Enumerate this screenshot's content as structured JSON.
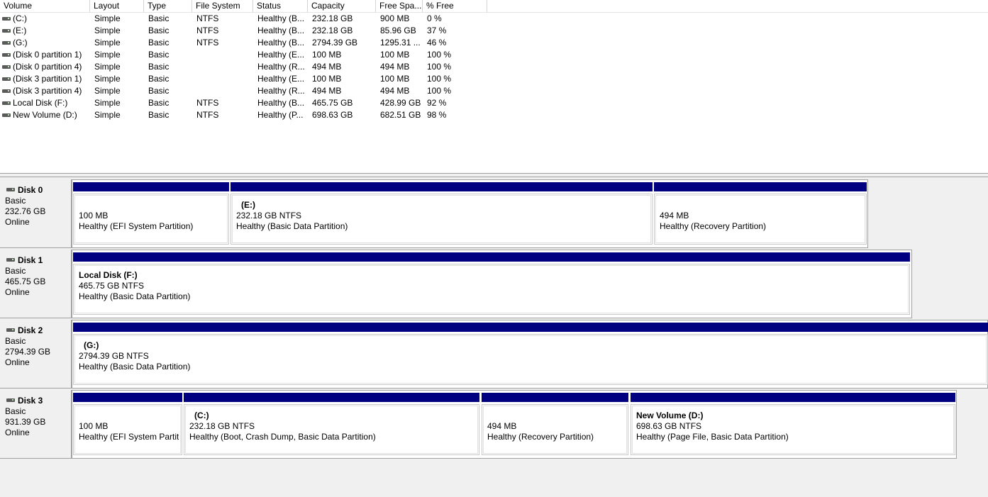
{
  "columns": [
    "Volume",
    "Layout",
    "Type",
    "File System",
    "Status",
    "Capacity",
    "Free Spa...",
    "% Free"
  ],
  "volumes": [
    {
      "volume": "(C:)",
      "layout": "Simple",
      "type": "Basic",
      "fs": "NTFS",
      "status": "Healthy (B...",
      "capacity": "232.18 GB",
      "free": "900 MB",
      "pct": "0 %"
    },
    {
      "volume": "(E:)",
      "layout": "Simple",
      "type": "Basic",
      "fs": "NTFS",
      "status": "Healthy (B...",
      "capacity": "232.18 GB",
      "free": "85.96 GB",
      "pct": "37 %"
    },
    {
      "volume": "(G:)",
      "layout": "Simple",
      "type": "Basic",
      "fs": "NTFS",
      "status": "Healthy (B...",
      "capacity": "2794.39 GB",
      "free": "1295.31 ...",
      "pct": "46 %"
    },
    {
      "volume": "(Disk 0 partition 1)",
      "layout": "Simple",
      "type": "Basic",
      "fs": "",
      "status": "Healthy (E...",
      "capacity": "100 MB",
      "free": "100 MB",
      "pct": "100 %"
    },
    {
      "volume": "(Disk 0 partition 4)",
      "layout": "Simple",
      "type": "Basic",
      "fs": "",
      "status": "Healthy (R...",
      "capacity": "494 MB",
      "free": "494 MB",
      "pct": "100 %"
    },
    {
      "volume": "(Disk 3 partition 1)",
      "layout": "Simple",
      "type": "Basic",
      "fs": "",
      "status": "Healthy (E...",
      "capacity": "100 MB",
      "free": "100 MB",
      "pct": "100 %"
    },
    {
      "volume": "(Disk 3 partition 4)",
      "layout": "Simple",
      "type": "Basic",
      "fs": "",
      "status": "Healthy (R...",
      "capacity": "494 MB",
      "free": "494 MB",
      "pct": "100 %"
    },
    {
      "volume": "Local Disk (F:)",
      "layout": "Simple",
      "type": "Basic",
      "fs": "NTFS",
      "status": "Healthy (B...",
      "capacity": "465.75 GB",
      "free": "428.99 GB",
      "pct": "92 %"
    },
    {
      "volume": "New Volume (D:)",
      "layout": "Simple",
      "type": "Basic",
      "fs": "NTFS",
      "status": "Healthy (P...",
      "capacity": "698.63 GB",
      "free": "682.51 GB",
      "pct": "98 %"
    }
  ],
  "disks": [
    {
      "name": "Disk 0",
      "type": "Basic",
      "size": "232.76 GB",
      "state": "Online",
      "partitions": [
        {
          "name": "",
          "size": "100 MB",
          "status": "Healthy (EFI System Partition)"
        },
        {
          "name": "(E:)",
          "size": "232.18 GB NTFS",
          "status": "Healthy (Basic Data Partition)"
        },
        {
          "name": "",
          "size": "494 MB",
          "status": "Healthy (Recovery Partition)"
        }
      ]
    },
    {
      "name": "Disk 1",
      "type": "Basic",
      "size": "465.75 GB",
      "state": "Online",
      "partitions": [
        {
          "name": "Local Disk  (F:)",
          "size": "465.75 GB NTFS",
          "status": "Healthy (Basic Data Partition)"
        }
      ]
    },
    {
      "name": "Disk 2",
      "type": "Basic",
      "size": "2794.39 GB",
      "state": "Online",
      "partitions": [
        {
          "name": "(G:)",
          "size": "2794.39 GB NTFS",
          "status": "Healthy (Basic Data Partition)"
        }
      ]
    },
    {
      "name": "Disk 3",
      "type": "Basic",
      "size": "931.39 GB",
      "state": "Online",
      "partitions": [
        {
          "name": "",
          "size": "100 MB",
          "status": "Healthy (EFI System Partition)"
        },
        {
          "name": "(C:)",
          "size": "232.18 GB NTFS",
          "status": "Healthy (Boot, Crash Dump, Basic Data Partition)"
        },
        {
          "name": "",
          "size": "494 MB",
          "status": "Healthy (Recovery Partition)"
        },
        {
          "name": "New Volume  (D:)",
          "size": "698.63 GB NTFS",
          "status": "Healthy (Page File, Basic Data Partition)"
        }
      ]
    }
  ],
  "colors": {
    "partition_bar": "#000080",
    "background": "#f0f0f0"
  }
}
